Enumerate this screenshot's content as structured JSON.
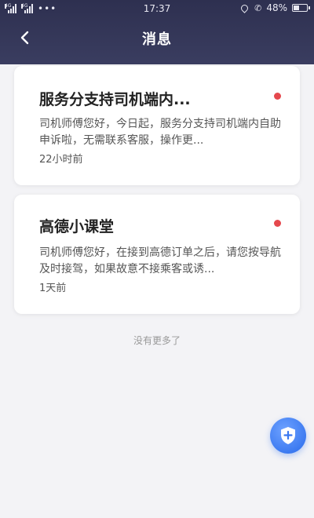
{
  "status_bar": {
    "network_left": "4G",
    "network_right": "4G",
    "dots": "•••",
    "time": "17:37",
    "battery_text": "48%",
    "battery_level": 0.48
  },
  "header": {
    "title": "消息",
    "back_icon": "chevron-left-icon"
  },
  "messages": [
    {
      "title": "服务分支持司机端内...",
      "body": "司机师傅您好，今日起，服务分支持司机端内自助申诉啦，无需联系客服，操作更...",
      "time": "22小时前",
      "unread": true
    },
    {
      "title": "高德小课堂",
      "body": "司机师傅您好，在接到高德订单之后，请您按导航及时接驾，如果故意不接乘客或诱...",
      "time": "1天前",
      "unread": true
    }
  ],
  "footer": {
    "no_more": "没有更多了"
  },
  "fab": {
    "icon": "shield-plus-icon"
  },
  "colors": {
    "header": "#2e3050",
    "unread": "#e5484d",
    "fab": "#3a78f0",
    "background": "#f3f3f6"
  }
}
